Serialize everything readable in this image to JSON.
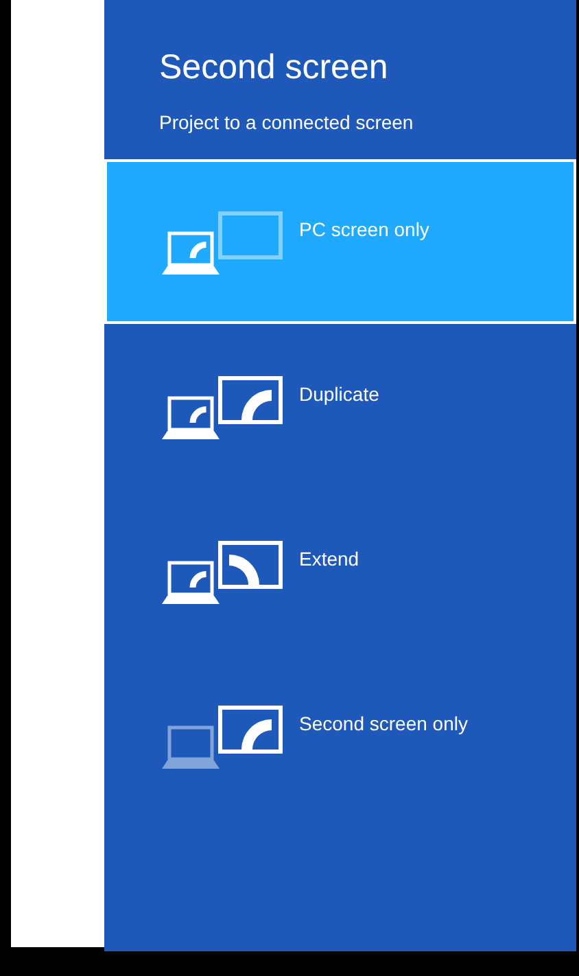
{
  "panel": {
    "title": "Second screen",
    "subtitle": "Project to a connected screen"
  },
  "options": [
    {
      "label": "PC screen only",
      "kind": "pc_only",
      "selected": true
    },
    {
      "label": "Duplicate",
      "kind": "duplicate",
      "selected": false
    },
    {
      "label": "Extend",
      "kind": "extend",
      "selected": false
    },
    {
      "label": "Second screen only",
      "kind": "second_only",
      "selected": false
    }
  ]
}
